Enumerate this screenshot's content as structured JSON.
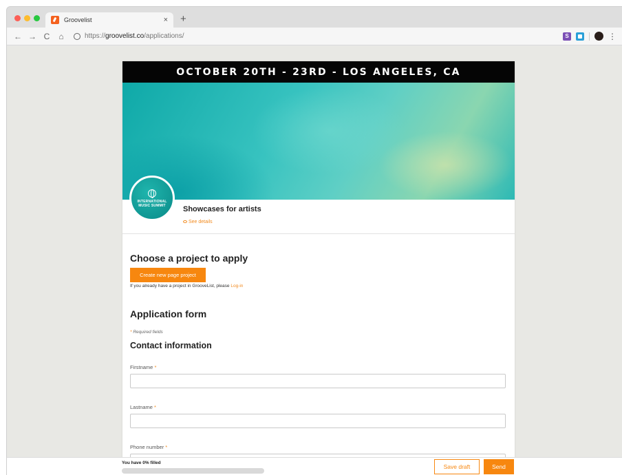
{
  "browser": {
    "tab_title": "Groovelist",
    "tab_close": "×",
    "new_tab": "+",
    "url_prefix": "https://",
    "url_host": "groovelist.co",
    "url_path": "/applications/",
    "nav": {
      "back": "←",
      "forward": "→",
      "reload": "C",
      "home": "⌂"
    },
    "extensions": [
      {
        "name": "s-extension-icon",
        "label": "S"
      }
    ]
  },
  "event": {
    "banner": "OCTOBER 20TH - 23RD - LOS ANGELES, CA",
    "logo_text": "INTERNATIONAL MUSIC SUMMIT",
    "title": "Showcases for artists",
    "see_details": "See details"
  },
  "choose": {
    "title": "Choose a project to apply",
    "create_button": "Create new page project",
    "login_note": "If you already have a project in GrooveList, please ",
    "login_link": "Log-in"
  },
  "form": {
    "title": "Application form",
    "required_asterisk": "*",
    "required_note": " Required fields",
    "contact_title": "Contact information",
    "fields": [
      {
        "label": "Firstname",
        "value": ""
      },
      {
        "label": "Lastname",
        "value": ""
      },
      {
        "label": "Phone number",
        "value": ""
      }
    ]
  },
  "footer": {
    "progress_text": "You have 0% filled",
    "progress_percent": 0,
    "save_draft": "Save draft",
    "send": "Send"
  },
  "colors": {
    "accent": "#f7870f",
    "banner_bg": "#050505",
    "hero_teal": "#1fb5ad"
  }
}
